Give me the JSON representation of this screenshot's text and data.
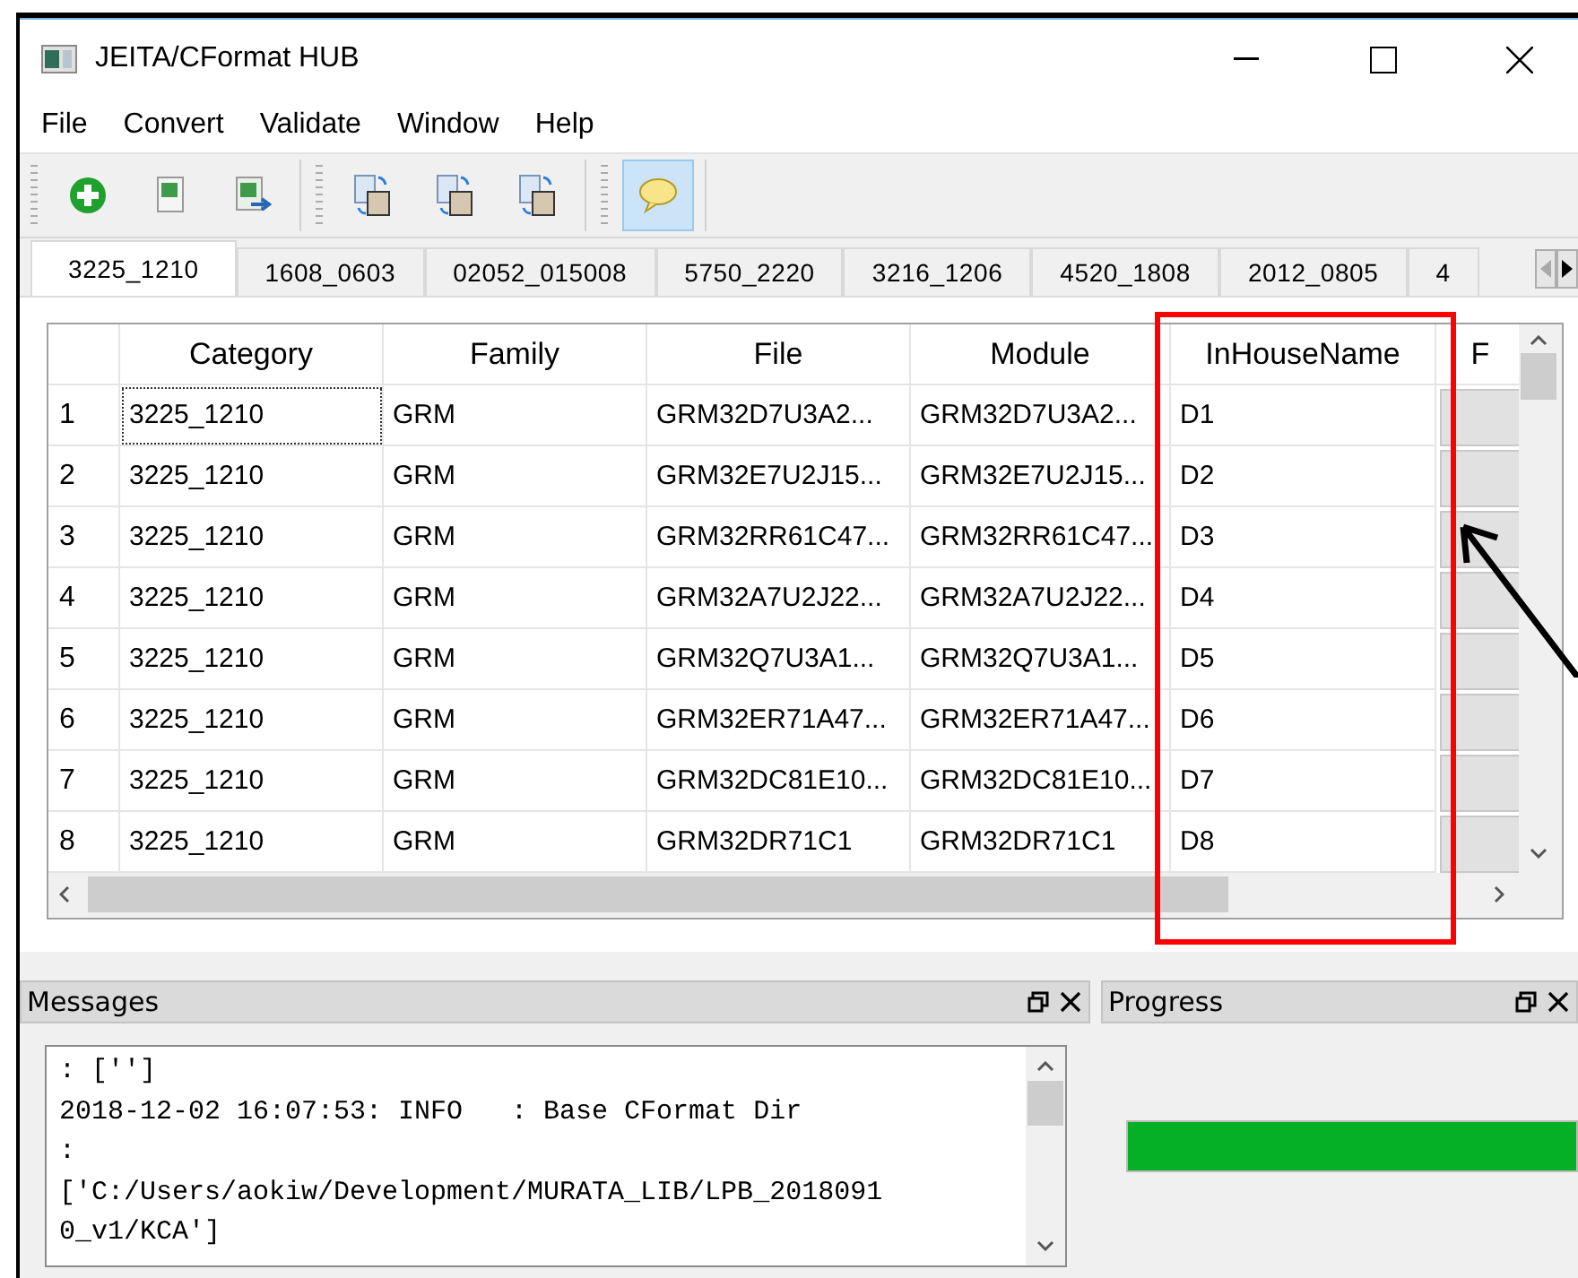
{
  "window": {
    "title": "JEITA/CFormat HUB"
  },
  "menu": [
    "File",
    "Convert",
    "Validate",
    "Window",
    "Help"
  ],
  "toolbar_groups": [
    [
      {
        "kind": "add",
        "checked": false
      },
      {
        "kind": "sheet",
        "checked": false
      },
      {
        "kind": "sheet-export",
        "checked": false
      }
    ],
    [
      {
        "kind": "convert",
        "checked": false
      },
      {
        "kind": "convert",
        "checked": false
      },
      {
        "kind": "convert",
        "checked": false
      }
    ],
    [
      {
        "kind": "comment",
        "checked": true
      }
    ]
  ],
  "tabs": [
    {
      "label": "3225_1210",
      "selected": true
    },
    {
      "label": "1608_0603",
      "selected": false
    },
    {
      "label": "02052_015008",
      "selected": false
    },
    {
      "label": "5750_2220",
      "selected": false
    },
    {
      "label": "3216_1206",
      "selected": false
    },
    {
      "label": "4520_1808",
      "selected": false
    },
    {
      "label": "2012_0805",
      "selected": false
    },
    {
      "label": "4",
      "selected": false
    }
  ],
  "table": {
    "columns": [
      "Category",
      "Family",
      "File",
      "Module",
      "InHouseName",
      "F"
    ],
    "rows": [
      {
        "number": "1",
        "focused": true,
        "cells": [
          "3225_1210",
          "GRM",
          "GRM32D7U3A2...",
          "GRM32D7U3A2...",
          "D1"
        ]
      },
      {
        "number": "2",
        "focused": false,
        "cells": [
          "3225_1210",
          "GRM",
          "GRM32E7U2J15...",
          "GRM32E7U2J15...",
          "D2"
        ]
      },
      {
        "number": "3",
        "focused": false,
        "cells": [
          "3225_1210",
          "GRM",
          "GRM32RR61C47...",
          "GRM32RR61C47...",
          "D3"
        ]
      },
      {
        "number": "4",
        "focused": false,
        "cells": [
          "3225_1210",
          "GRM",
          "GRM32A7U2J22...",
          "GRM32A7U2J22...",
          "D4"
        ]
      },
      {
        "number": "5",
        "focused": false,
        "cells": [
          "3225_1210",
          "GRM",
          "GRM32Q7U3A1...",
          "GRM32Q7U3A1...",
          "D5"
        ]
      },
      {
        "number": "6",
        "focused": false,
        "cells": [
          "3225_1210",
          "GRM",
          "GRM32ER71A47...",
          "GRM32ER71A47...",
          "D6"
        ]
      },
      {
        "number": "7",
        "focused": false,
        "cells": [
          "3225_1210",
          "GRM",
          "GRM32DC81E10...",
          "GRM32DC81E10...",
          "D7"
        ]
      },
      {
        "number": "8",
        "focused": false,
        "cells": [
          "3225_1210",
          "GRM",
          "GRM32DR71C1",
          "GRM32DR71C1",
          "D8"
        ]
      }
    ]
  },
  "messages_panel": {
    "title": "Messages",
    "lines": [
      ": ['']",
      "2018-12-02 16:07:53: INFO   : Base CFormat Dir",
      ":",
      "['C:/Users/aokiw/Development/MURATA_LIB/LPB_2018091",
      "0_v1/KCA']"
    ]
  },
  "progress_panel": {
    "title": "Progress",
    "level": 1
  }
}
